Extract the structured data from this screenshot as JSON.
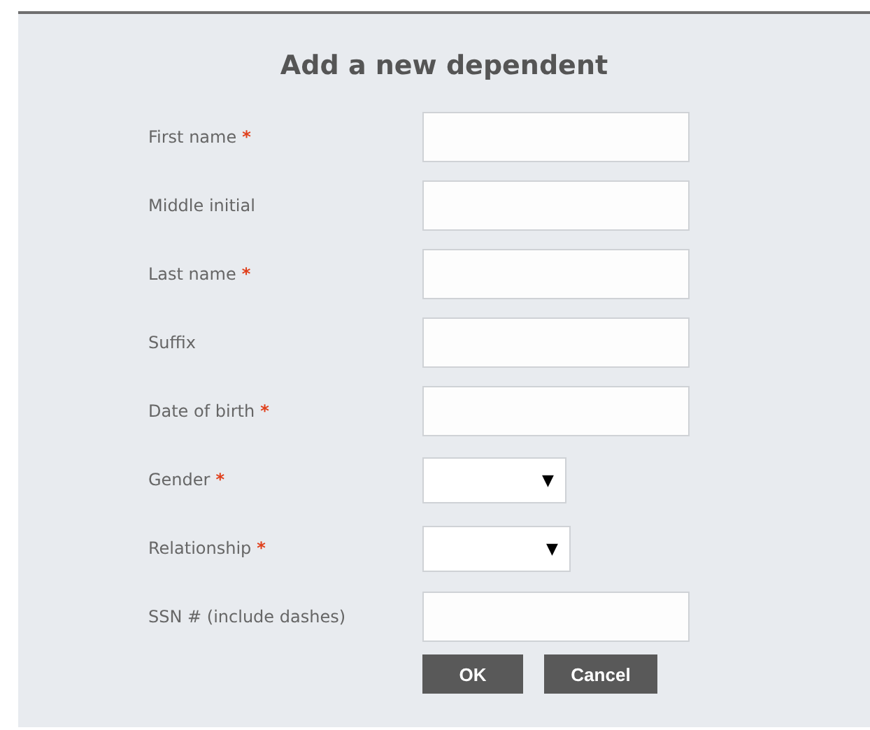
{
  "title": "Add a new dependent",
  "required_mark": "*",
  "fields": [
    {
      "label": "First name",
      "required": true,
      "kind": "text"
    },
    {
      "label": "Middle initial",
      "required": false,
      "kind": "text"
    },
    {
      "label": "Last name",
      "required": true,
      "kind": "text"
    },
    {
      "label": "Suffix",
      "required": false,
      "kind": "text"
    },
    {
      "label": "Date of birth",
      "required": true,
      "kind": "text"
    },
    {
      "label": "Gender",
      "required": true,
      "kind": "select",
      "arrow": "▼"
    },
    {
      "label": "Relationship",
      "required": true,
      "kind": "select",
      "arrow": "▼"
    },
    {
      "label": "SSN # (include dashes)",
      "required": false,
      "kind": "text"
    }
  ],
  "buttons": [
    "OK",
    "Cancel"
  ]
}
